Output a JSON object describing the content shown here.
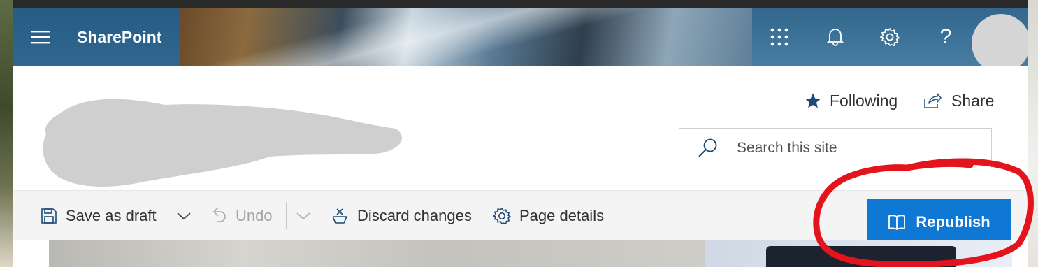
{
  "suite_bar": {
    "brand": "SharePoint",
    "icons": [
      "hamburger-menu-icon",
      "app-launcher-icon",
      "bell-icon",
      "gear-icon",
      "help-icon"
    ],
    "help_glyph": "?"
  },
  "site_header": {
    "following_label": "Following",
    "share_label": "Share",
    "search_placeholder": "Search this site"
  },
  "command_bar": {
    "save_draft_label": "Save as draft",
    "undo_label": "Undo",
    "discard_label": "Discard changes",
    "page_details_label": "Page details",
    "republish_label": "Republish"
  },
  "colors": {
    "accent": "#0f78d4",
    "follow_star": "#1c4a78",
    "annotation": "#e3141b"
  }
}
